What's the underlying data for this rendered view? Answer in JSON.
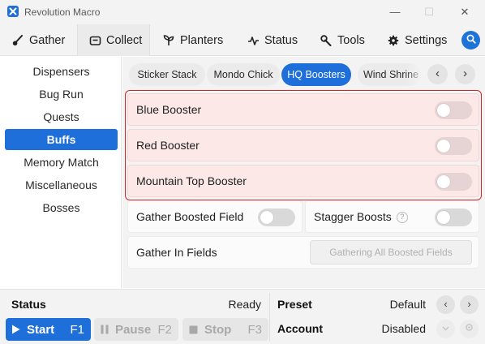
{
  "window": {
    "title": "Revolution Macro",
    "minimize_glyph": "—",
    "maximize_glyph": "☐",
    "close_glyph": "✕"
  },
  "main_tabs": [
    {
      "label": "Gather",
      "icon": "brush-icon"
    },
    {
      "label": "Collect",
      "icon": "collect-icon",
      "active": true
    },
    {
      "label": "Planters",
      "icon": "sprout-icon"
    },
    {
      "label": "Status",
      "icon": "pulse-icon"
    },
    {
      "label": "Tools",
      "icon": "wrench-icon"
    },
    {
      "label": "Settings",
      "icon": "gear-icon"
    }
  ],
  "sidebar": {
    "items": [
      {
        "label": "Dispensers"
      },
      {
        "label": "Bug Run"
      },
      {
        "label": "Quests"
      },
      {
        "label": "Buffs",
        "active": true
      },
      {
        "label": "Memory Match"
      },
      {
        "label": "Miscellaneous"
      },
      {
        "label": "Bosses"
      }
    ]
  },
  "subtabs": [
    {
      "label": "Sticker Stack"
    },
    {
      "label": "Mondo Chick"
    },
    {
      "label": "HQ Boosters",
      "active": true
    },
    {
      "label": "Wind Shrine"
    }
  ],
  "subtab_nav": {
    "prev": "‹",
    "next": "›"
  },
  "boosters": [
    {
      "label": "Blue Booster",
      "enabled": false
    },
    {
      "label": "Red Booster",
      "enabled": false
    },
    {
      "label": "Mountain Top Booster",
      "enabled": false
    }
  ],
  "options": {
    "gather_boosted_field": {
      "label": "Gather Boosted Field",
      "enabled": false
    },
    "stagger_boosts": {
      "label": "Stagger Boosts",
      "help": "?",
      "enabled": false
    },
    "gather_in_fields": {
      "label": "Gather In Fields",
      "button": "Gathering All Boosted Fields"
    }
  },
  "footer": {
    "status_label": "Status",
    "status_value": "Ready",
    "preset_label": "Preset",
    "preset_value": "Default",
    "account_label": "Account",
    "account_value": "Disabled",
    "start": {
      "label": "Start",
      "key": "F1"
    },
    "pause": {
      "label": "Pause",
      "key": "F2"
    },
    "stop": {
      "label": "Stop",
      "key": "F3"
    }
  },
  "colors": {
    "accent": "#1e6fd9",
    "highlight_border": "#cc2a2a",
    "highlight_fill": "#fde8e8"
  }
}
